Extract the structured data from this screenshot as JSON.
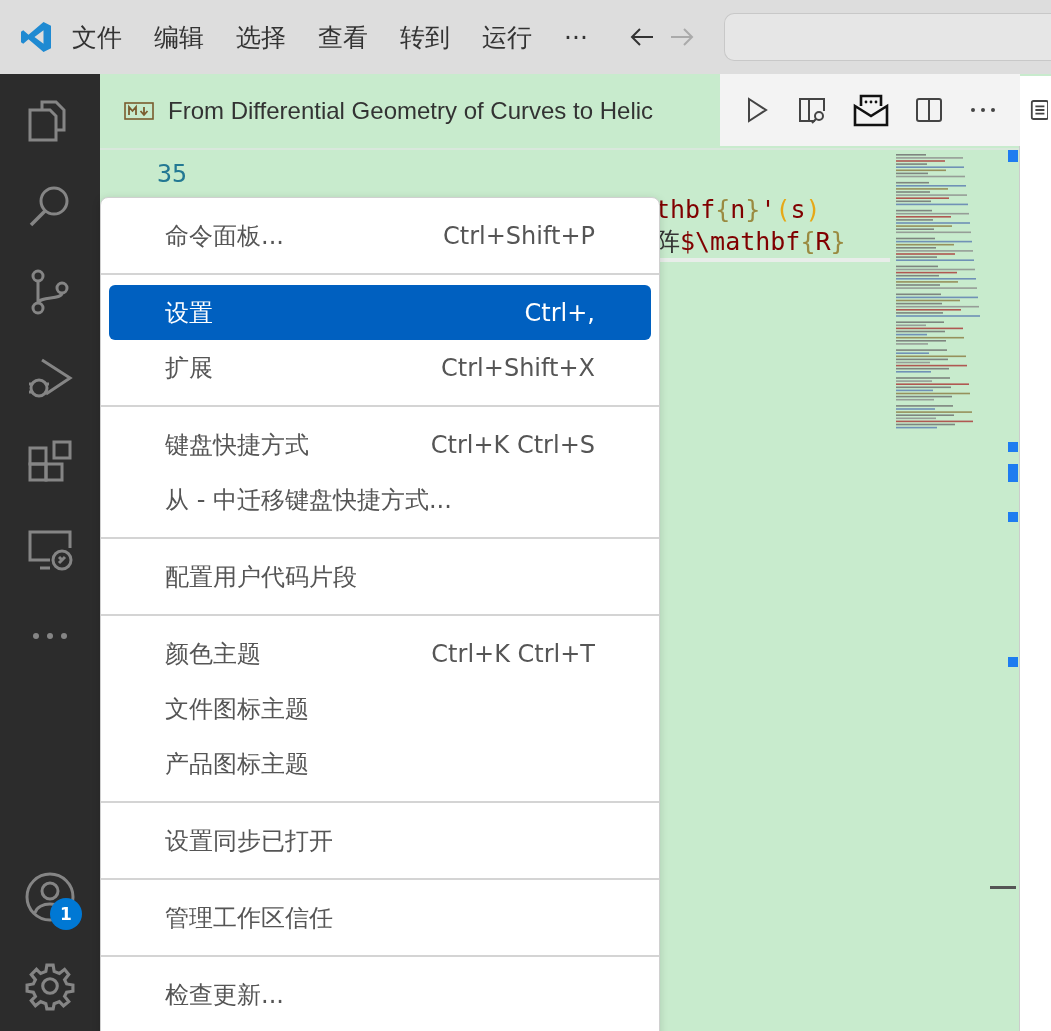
{
  "title_bar": {
    "menus": [
      "文件",
      "编辑",
      "选择",
      "查看",
      "转到",
      "运行"
    ],
    "more": "···",
    "back_enabled": true,
    "forward_enabled": false
  },
  "tab": {
    "title": "From Differential Geometry of Curves to Helic"
  },
  "editor": {
    "line_number": "35",
    "code_lines": [
      [
        {
          "text": "thbf",
          "kind": "command"
        },
        {
          "text": "{",
          "kind": "brace"
        },
        {
          "text": "n",
          "kind": "command"
        },
        {
          "text": "}",
          "kind": "brace"
        },
        {
          "text": "'",
          "kind": "command"
        },
        {
          "text": "(",
          "kind": "paren"
        },
        {
          "text": "s",
          "kind": "command"
        },
        {
          "text": ")",
          "kind": "paren"
        }
      ],
      [
        {
          "text": "阵",
          "kind": "plain"
        },
        {
          "text": "$\\mathbf",
          "kind": "command"
        },
        {
          "text": "{",
          "kind": "brace"
        },
        {
          "text": "R",
          "kind": "command"
        },
        {
          "text": "}",
          "kind": "brace"
        }
      ]
    ]
  },
  "accounts_badge": "1",
  "menu": {
    "groups": [
      [
        {
          "label": "命令面板...",
          "shortcut": "Ctrl+Shift+P",
          "selected": false
        }
      ],
      [
        {
          "label": "设置",
          "shortcut": "Ctrl+,",
          "selected": true
        },
        {
          "label": "扩展",
          "shortcut": "Ctrl+Shift+X",
          "selected": false
        }
      ],
      [
        {
          "label": "键盘快捷方式",
          "shortcut": "Ctrl+K Ctrl+S",
          "selected": false
        },
        {
          "label": "从 - 中迁移键盘快捷方式...",
          "selected": false
        }
      ],
      [
        {
          "label": "配置用户代码片段",
          "selected": false
        }
      ],
      [
        {
          "label": "颜色主题",
          "shortcut": "Ctrl+K Ctrl+T",
          "selected": false
        },
        {
          "label": "文件图标主题",
          "selected": false
        },
        {
          "label": "产品图标主题",
          "selected": false
        }
      ],
      [
        {
          "label": "设置同步已打开",
          "selected": false
        }
      ],
      [
        {
          "label": "管理工作区信任",
          "selected": false
        }
      ],
      [
        {
          "label": "检查更新...",
          "selected": false
        }
      ]
    ]
  }
}
